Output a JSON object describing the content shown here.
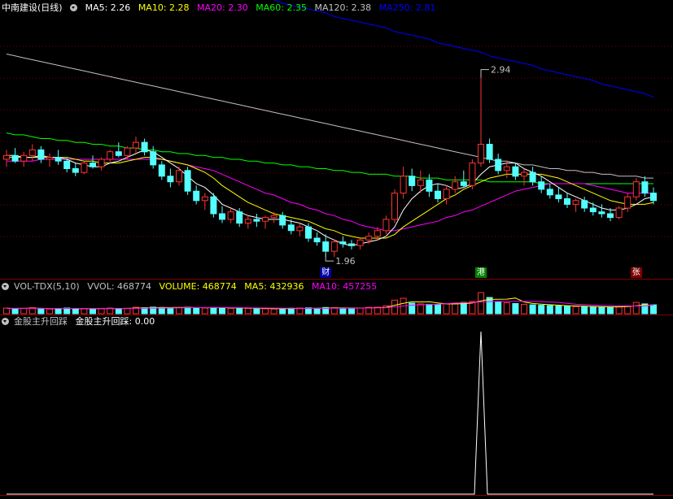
{
  "main": {
    "title": "中南建设(日线)",
    "ma": [
      {
        "label": "MA5: 2.26",
        "color": "#ffffff"
      },
      {
        "label": "MA10: 2.28",
        "color": "#ffff00"
      },
      {
        "label": "MA20: 2.30",
        "color": "#ff00ff"
      },
      {
        "label": "MA60: 2.35",
        "color": "#00ff00"
      },
      {
        "label": "MA120: 2.38",
        "color": "#c0c0c0"
      },
      {
        "label": "MA250: 2.81",
        "color": "#0000ff"
      }
    ],
    "high_label": "2.94",
    "low_label": "1.96",
    "markers": [
      {
        "text": "财",
        "color": "#ffffff",
        "bg": "#0000a0"
      },
      {
        "text": "港",
        "color": "#ffffff",
        "bg": "#008000"
      },
      {
        "text": "张",
        "color": "#ffffff",
        "bg": "#800000"
      }
    ]
  },
  "volume": {
    "title": "VOL-TDX(5,10)",
    "items": [
      {
        "label": "VVOL: 468774",
        "color": "#c0c0c0"
      },
      {
        "label": "VOLUME: 468774",
        "color": "#ffff00"
      },
      {
        "label": "MA5: 432936",
        "color": "#ffff00"
      },
      {
        "label": "MA10: 457255",
        "color": "#ff00ff"
      }
    ]
  },
  "indicator": {
    "title": "金股主升回踩",
    "value_label": "金股主升回踩: 0.00"
  },
  "chart_data": {
    "type": "candlestick",
    "price_range": [
      1.9,
      3.25
    ],
    "candles": [
      [
        2.48,
        2.53,
        2.44,
        2.5
      ],
      [
        2.5,
        2.54,
        2.46,
        2.47
      ],
      [
        2.47,
        2.52,
        2.44,
        2.5
      ],
      [
        2.5,
        2.56,
        2.47,
        2.53
      ],
      [
        2.53,
        2.55,
        2.46,
        2.48
      ],
      [
        2.48,
        2.51,
        2.44,
        2.49
      ],
      [
        2.49,
        2.53,
        2.45,
        2.47
      ],
      [
        2.47,
        2.49,
        2.41,
        2.43
      ],
      [
        2.43,
        2.46,
        2.39,
        2.41
      ],
      [
        2.41,
        2.47,
        2.4,
        2.46
      ],
      [
        2.46,
        2.5,
        2.43,
        2.44
      ],
      [
        2.44,
        2.49,
        2.42,
        2.48
      ],
      [
        2.48,
        2.53,
        2.46,
        2.52
      ],
      [
        2.52,
        2.57,
        2.49,
        2.5
      ],
      [
        2.5,
        2.55,
        2.48,
        2.54
      ],
      [
        2.54,
        2.6,
        2.51,
        2.57
      ],
      [
        2.57,
        2.59,
        2.5,
        2.52
      ],
      [
        2.52,
        2.55,
        2.43,
        2.45
      ],
      [
        2.45,
        2.47,
        2.37,
        2.39
      ],
      [
        2.39,
        2.43,
        2.33,
        2.36
      ],
      [
        2.36,
        2.44,
        2.34,
        2.42
      ],
      [
        2.42,
        2.44,
        2.29,
        2.31
      ],
      [
        2.31,
        2.34,
        2.24,
        2.26
      ],
      [
        2.26,
        2.3,
        2.21,
        2.28
      ],
      [
        2.28,
        2.3,
        2.17,
        2.19
      ],
      [
        2.19,
        2.23,
        2.14,
        2.16
      ],
      [
        2.16,
        2.22,
        2.14,
        2.2
      ],
      [
        2.2,
        2.22,
        2.12,
        2.14
      ],
      [
        2.14,
        2.18,
        2.11,
        2.16
      ],
      [
        2.16,
        2.19,
        2.12,
        2.15
      ],
      [
        2.15,
        2.18,
        2.11,
        2.17
      ],
      [
        2.17,
        2.2,
        2.14,
        2.18
      ],
      [
        2.18,
        2.2,
        2.11,
        2.13
      ],
      [
        2.13,
        2.16,
        2.08,
        2.1
      ],
      [
        2.1,
        2.14,
        2.07,
        2.12
      ],
      [
        2.12,
        2.14,
        2.04,
        2.06
      ],
      [
        2.06,
        2.09,
        2.02,
        2.04
      ],
      [
        2.04,
        2.08,
        1.96,
        1.99
      ],
      [
        1.99,
        2.05,
        1.96,
        2.04
      ],
      [
        2.04,
        2.07,
        2.01,
        2.03
      ],
      [
        2.03,
        2.05,
        2.0,
        2.02
      ],
      [
        2.02,
        2.06,
        2.0,
        2.05
      ],
      [
        2.05,
        2.09,
        2.03,
        2.07
      ],
      [
        2.07,
        2.12,
        2.05,
        2.1
      ],
      [
        2.1,
        2.18,
        2.08,
        2.16
      ],
      [
        2.16,
        2.32,
        2.14,
        2.3
      ],
      [
        2.3,
        2.44,
        2.27,
        2.39
      ],
      [
        2.39,
        2.43,
        2.31,
        2.34
      ],
      [
        2.34,
        2.42,
        2.3,
        2.37
      ],
      [
        2.37,
        2.4,
        2.28,
        2.31
      ],
      [
        2.31,
        2.35,
        2.25,
        2.27
      ],
      [
        2.27,
        2.34,
        2.24,
        2.32
      ],
      [
        2.32,
        2.39,
        2.3,
        2.36
      ],
      [
        2.36,
        2.42,
        2.33,
        2.34
      ],
      [
        2.34,
        2.48,
        2.32,
        2.46
      ],
      [
        2.46,
        2.94,
        2.44,
        2.56
      ],
      [
        2.56,
        2.59,
        2.46,
        2.48
      ],
      [
        2.48,
        2.51,
        2.4,
        2.42
      ],
      [
        2.42,
        2.47,
        2.38,
        2.44
      ],
      [
        2.44,
        2.46,
        2.37,
        2.39
      ],
      [
        2.39,
        2.43,
        2.34,
        2.41
      ],
      [
        2.41,
        2.44,
        2.34,
        2.36
      ],
      [
        2.36,
        2.39,
        2.3,
        2.32
      ],
      [
        2.32,
        2.35,
        2.27,
        2.29
      ],
      [
        2.29,
        2.33,
        2.25,
        2.27
      ],
      [
        2.27,
        2.3,
        2.22,
        2.24
      ],
      [
        2.24,
        2.27,
        2.2,
        2.26
      ],
      [
        2.26,
        2.28,
        2.2,
        2.22
      ],
      [
        2.22,
        2.25,
        2.18,
        2.2
      ],
      [
        2.2,
        2.24,
        2.17,
        2.19
      ],
      [
        2.19,
        2.22,
        2.15,
        2.17
      ],
      [
        2.17,
        2.23,
        2.16,
        2.22
      ],
      [
        2.22,
        2.3,
        2.2,
        2.28
      ],
      [
        2.28,
        2.38,
        2.26,
        2.36
      ],
      [
        2.36,
        2.39,
        2.28,
        2.3
      ],
      [
        2.3,
        2.33,
        2.24,
        2.26
      ]
    ],
    "ma5": [
      2.5,
      2.5,
      2.49,
      2.49,
      2.5,
      2.49,
      2.49,
      2.48,
      2.46,
      2.45,
      2.44,
      2.44,
      2.46,
      2.47,
      2.49,
      2.51,
      2.53,
      2.52,
      2.49,
      2.46,
      2.43,
      2.39,
      2.35,
      2.33,
      2.29,
      2.24,
      2.22,
      2.2,
      2.18,
      2.17,
      2.16,
      2.16,
      2.16,
      2.15,
      2.14,
      2.12,
      2.1,
      2.07,
      2.05,
      2.03,
      2.02,
      2.03,
      2.04,
      2.05,
      2.07,
      2.12,
      2.21,
      2.27,
      2.31,
      2.34,
      2.35,
      2.34,
      2.32,
      2.33,
      2.35,
      2.4,
      2.44,
      2.45,
      2.46,
      2.46,
      2.43,
      2.41,
      2.39,
      2.36,
      2.33,
      2.3,
      2.28,
      2.26,
      2.24,
      2.22,
      2.21,
      2.21,
      2.22,
      2.24,
      2.27,
      2.28
    ],
    "ma10": [
      2.49,
      2.49,
      2.49,
      2.49,
      2.49,
      2.49,
      2.49,
      2.49,
      2.48,
      2.47,
      2.47,
      2.46,
      2.46,
      2.46,
      2.47,
      2.48,
      2.49,
      2.49,
      2.48,
      2.47,
      2.46,
      2.45,
      2.43,
      2.41,
      2.38,
      2.34,
      2.31,
      2.28,
      2.25,
      2.23,
      2.21,
      2.19,
      2.18,
      2.17,
      2.16,
      2.15,
      2.13,
      2.11,
      2.1,
      2.08,
      2.07,
      2.06,
      2.06,
      2.06,
      2.06,
      2.08,
      2.12,
      2.15,
      2.18,
      2.21,
      2.24,
      2.27,
      2.29,
      2.32,
      2.34,
      2.36,
      2.38,
      2.39,
      2.4,
      2.4,
      2.4,
      2.4,
      2.4,
      2.39,
      2.38,
      2.36,
      2.34,
      2.32,
      2.3,
      2.28,
      2.26,
      2.25,
      2.24,
      2.24,
      2.24,
      2.25
    ],
    "ma20": [
      2.47,
      2.47,
      2.47,
      2.47,
      2.48,
      2.48,
      2.48,
      2.48,
      2.48,
      2.48,
      2.48,
      2.48,
      2.48,
      2.48,
      2.48,
      2.48,
      2.48,
      2.48,
      2.48,
      2.47,
      2.46,
      2.45,
      2.44,
      2.43,
      2.42,
      2.4,
      2.38,
      2.36,
      2.34,
      2.32,
      2.3,
      2.29,
      2.27,
      2.25,
      2.24,
      2.22,
      2.21,
      2.19,
      2.18,
      2.16,
      2.15,
      2.13,
      2.12,
      2.11,
      2.1,
      2.1,
      2.11,
      2.12,
      2.13,
      2.14,
      2.15,
      2.17,
      2.18,
      2.2,
      2.21,
      2.23,
      2.25,
      2.27,
      2.29,
      2.31,
      2.32,
      2.33,
      2.34,
      2.35,
      2.35,
      2.35,
      2.35,
      2.35,
      2.34,
      2.33,
      2.32,
      2.31,
      2.3,
      2.3,
      2.3,
      2.3
    ],
    "ma60": [
      2.62,
      2.61,
      2.61,
      2.6,
      2.59,
      2.59,
      2.58,
      2.58,
      2.57,
      2.57,
      2.56,
      2.56,
      2.55,
      2.55,
      2.54,
      2.54,
      2.53,
      2.53,
      2.52,
      2.52,
      2.51,
      2.51,
      2.5,
      2.5,
      2.49,
      2.49,
      2.48,
      2.48,
      2.47,
      2.47,
      2.46,
      2.46,
      2.45,
      2.45,
      2.44,
      2.44,
      2.43,
      2.43,
      2.42,
      2.42,
      2.41,
      2.41,
      2.4,
      2.4,
      2.4,
      2.39,
      2.39,
      2.39,
      2.38,
      2.38,
      2.38,
      2.37,
      2.37,
      2.37,
      2.37,
      2.37,
      2.36,
      2.36,
      2.36,
      2.36,
      2.36,
      2.36,
      2.35,
      2.35,
      2.35,
      2.35,
      2.35,
      2.35,
      2.35,
      2.35,
      2.35,
      2.35,
      2.35,
      2.35,
      2.35,
      2.35
    ],
    "ma120": [
      3.04,
      3.03,
      3.02,
      3.01,
      3.0,
      2.99,
      2.98,
      2.97,
      2.96,
      2.95,
      2.94,
      2.93,
      2.92,
      2.91,
      2.9,
      2.89,
      2.88,
      2.87,
      2.86,
      2.85,
      2.84,
      2.83,
      2.82,
      2.81,
      2.8,
      2.79,
      2.78,
      2.77,
      2.76,
      2.75,
      2.74,
      2.73,
      2.72,
      2.71,
      2.7,
      2.69,
      2.68,
      2.67,
      2.66,
      2.65,
      2.64,
      2.63,
      2.62,
      2.61,
      2.6,
      2.59,
      2.58,
      2.57,
      2.56,
      2.55,
      2.54,
      2.53,
      2.52,
      2.51,
      2.5,
      2.49,
      2.48,
      2.47,
      2.47,
      2.46,
      2.45,
      2.45,
      2.44,
      2.43,
      2.43,
      2.42,
      2.42,
      2.41,
      2.41,
      2.4,
      2.4,
      2.39,
      2.39,
      2.39,
      2.38,
      2.38
    ],
    "ma250": [
      3.72,
      3.71,
      3.69,
      3.68,
      3.66,
      3.65,
      3.64,
      3.62,
      3.61,
      3.6,
      3.58,
      3.57,
      3.56,
      3.54,
      3.53,
      3.52,
      3.51,
      3.49,
      3.48,
      3.47,
      3.46,
      3.44,
      3.43,
      3.42,
      3.41,
      3.4,
      3.38,
      3.37,
      3.36,
      3.35,
      3.34,
      3.33,
      3.31,
      3.3,
      3.29,
      3.28,
      3.27,
      3.26,
      3.24,
      3.23,
      3.22,
      3.21,
      3.2,
      3.19,
      3.18,
      3.16,
      3.15,
      3.14,
      3.13,
      3.12,
      3.1,
      3.09,
      3.08,
      3.07,
      3.06,
      3.05,
      3.03,
      3.02,
      3.01,
      3.0,
      2.99,
      2.98,
      2.96,
      2.95,
      2.94,
      2.93,
      2.92,
      2.91,
      2.9,
      2.88,
      2.87,
      2.86,
      2.85,
      2.84,
      2.83,
      2.81
    ],
    "volume": [
      300000,
      260000,
      280000,
      320000,
      270000,
      250000,
      240000,
      300000,
      280000,
      260000,
      250000,
      270000,
      300000,
      280000,
      290000,
      340000,
      320000,
      350000,
      330000,
      300000,
      310000,
      340000,
      320000,
      300000,
      330000,
      310000,
      290000,
      300000,
      280000,
      270000,
      260000,
      250000,
      270000,
      290000,
      300000,
      310000,
      280000,
      330000,
      320000,
      290000,
      280000,
      300000,
      340000,
      350000,
      420000,
      720000,
      820000,
      560000,
      520000,
      500000,
      480000,
      530000,
      560000,
      600000,
      650000,
      1120000,
      860000,
      620000,
      580000,
      540000,
      500000,
      470000,
      450000,
      430000,
      410000,
      390000,
      380000,
      370000,
      360000,
      350000,
      340000,
      360000,
      420000,
      600000,
      520000,
      468774
    ],
    "vol_ma5": [
      280000,
      280000,
      285000,
      290000,
      286000,
      276000,
      272000,
      278000,
      270000,
      266000,
      266000,
      272000,
      276000,
      276000,
      280000,
      296000,
      306000,
      316000,
      326000,
      328000,
      330000,
      330000,
      326000,
      320000,
      320000,
      322000,
      312000,
      306000,
      302000,
      290000,
      280000,
      272000,
      270000,
      274000,
      276000,
      284000,
      292000,
      298000,
      304000,
      306000,
      302000,
      302000,
      308000,
      318000,
      338000,
      446000,
      550000,
      632000,
      624000,
      634000,
      568000,
      522000,
      518000,
      534000,
      564000,
      680000,
      758000,
      766000,
      770000,
      832000,
      620000,
      542000,
      508000,
      478000,
      452000,
      428000,
      410000,
      396000,
      382000,
      370000,
      362000,
      360000,
      374000,
      418000,
      456000,
      432936
    ],
    "vol_ma10": [
      285000,
      284000,
      284000,
      285000,
      284000,
      280000,
      278000,
      278000,
      278000,
      276000,
      273000,
      273000,
      275000,
      275000,
      276000,
      282000,
      289000,
      297000,
      303000,
      308000,
      313000,
      319000,
      322000,
      322000,
      325000,
      326000,
      322000,
      318000,
      314000,
      308000,
      303000,
      297000,
      292000,
      290000,
      286000,
      283000,
      283000,
      284000,
      287000,
      290000,
      292000,
      296000,
      303000,
      310000,
      318000,
      360000,
      410000,
      458000,
      474000,
      486000,
      507000,
      534000,
      569000,
      581000,
      600000,
      624000,
      640000,
      650000,
      652000,
      660000,
      652000,
      650000,
      640000,
      620000,
      600000,
      552000,
      500000,
      476000,
      456000,
      440000,
      427000,
      415000,
      408000,
      410000,
      414000,
      457255
    ],
    "indicator_values": [
      0,
      0,
      0,
      0,
      0,
      0,
      0,
      0,
      0,
      0,
      0,
      0,
      0,
      0,
      0,
      0,
      0,
      0,
      0,
      0,
      0,
      0,
      0,
      0,
      0,
      0,
      0,
      0,
      0,
      0,
      0,
      0,
      0,
      0,
      0,
      0,
      0,
      0,
      0,
      0,
      0,
      0,
      0,
      0,
      0,
      0,
      0,
      0,
      0,
      0,
      0,
      0,
      0,
      0,
      0,
      0,
      0,
      0,
      0,
      0,
      0,
      0,
      0,
      0,
      0,
      0,
      0,
      0,
      0,
      0,
      0,
      0,
      0,
      0,
      0,
      0
    ],
    "indicator_spikes": [
      {
        "index": 55,
        "value": 1
      }
    ],
    "indicator_range": [
      0,
      1.05
    ],
    "high_index": 55,
    "low_index": 37,
    "marker_indices": [
      37,
      55,
      73
    ]
  }
}
